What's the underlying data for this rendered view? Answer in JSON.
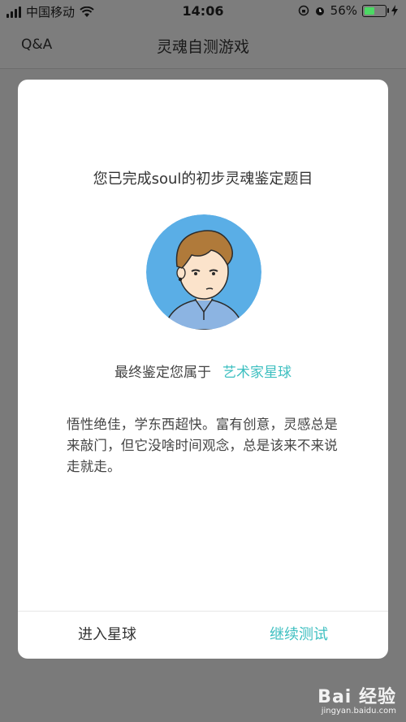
{
  "status_bar": {
    "carrier": "中国移动",
    "time": "14:06",
    "battery_percent": "56%",
    "battery_level": 0.56
  },
  "nav": {
    "back_label": "Q&A",
    "title": "灵魂自测游戏"
  },
  "dialog": {
    "heading": "您已完成soul的初步灵魂鉴定题目",
    "verdict_prefix": "最终鉴定您属于",
    "planet_name": "艺术家星球",
    "description": "悟性绝佳，学东西超快。富有创意，灵感总是来敲门，但它没啥时间观念，总是该来不来说走就走。",
    "enter_button": "进入星球",
    "continue_button": "继续测试"
  },
  "watermark": {
    "brand": "Bai  经验",
    "url": "jingyan.baidu.com"
  },
  "colors": {
    "accent": "#3dbfc0",
    "overlay": "#7a7a7a",
    "avatar_bg": "#5aaee6"
  }
}
